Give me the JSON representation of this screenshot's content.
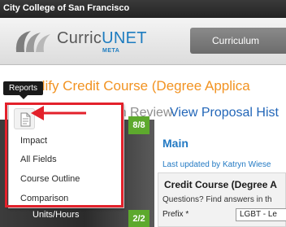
{
  "topbar": {
    "college": "City College of San Francisco"
  },
  "header": {
    "logo_main": "Curric",
    "logo_accent": "UNET",
    "logo_sub": "META",
    "nav_button": "Curriculum"
  },
  "page": {
    "title": "dify Credit Course (Degree Applica",
    "status": "Status: In Review",
    "proposal_link": "View Proposal Hist"
  },
  "tooltip": {
    "text": "Reports"
  },
  "reports_menu": {
    "icon": "document-icon",
    "items": [
      {
        "label": "Impact"
      },
      {
        "label": "All Fields"
      },
      {
        "label": "Course Outline"
      },
      {
        "label": "Comparison"
      }
    ]
  },
  "sidebar": {
    "badge_top": "8/8",
    "badge_bottom": "2/2",
    "units_label": "Units/Hours"
  },
  "main": {
    "heading": "Main",
    "last_updated": "Last updated by Katryn Wiese",
    "card_title": "Credit Course (Degree A",
    "questions": "Questions? Find answers in th",
    "prefix_label": "Prefix *",
    "prefix_value": "LGBT - Le"
  },
  "colors": {
    "accent_blue": "#2279c3",
    "title_orange": "#f29322",
    "badge_green": "#5da92d",
    "highlight_red": "#e3212b"
  }
}
